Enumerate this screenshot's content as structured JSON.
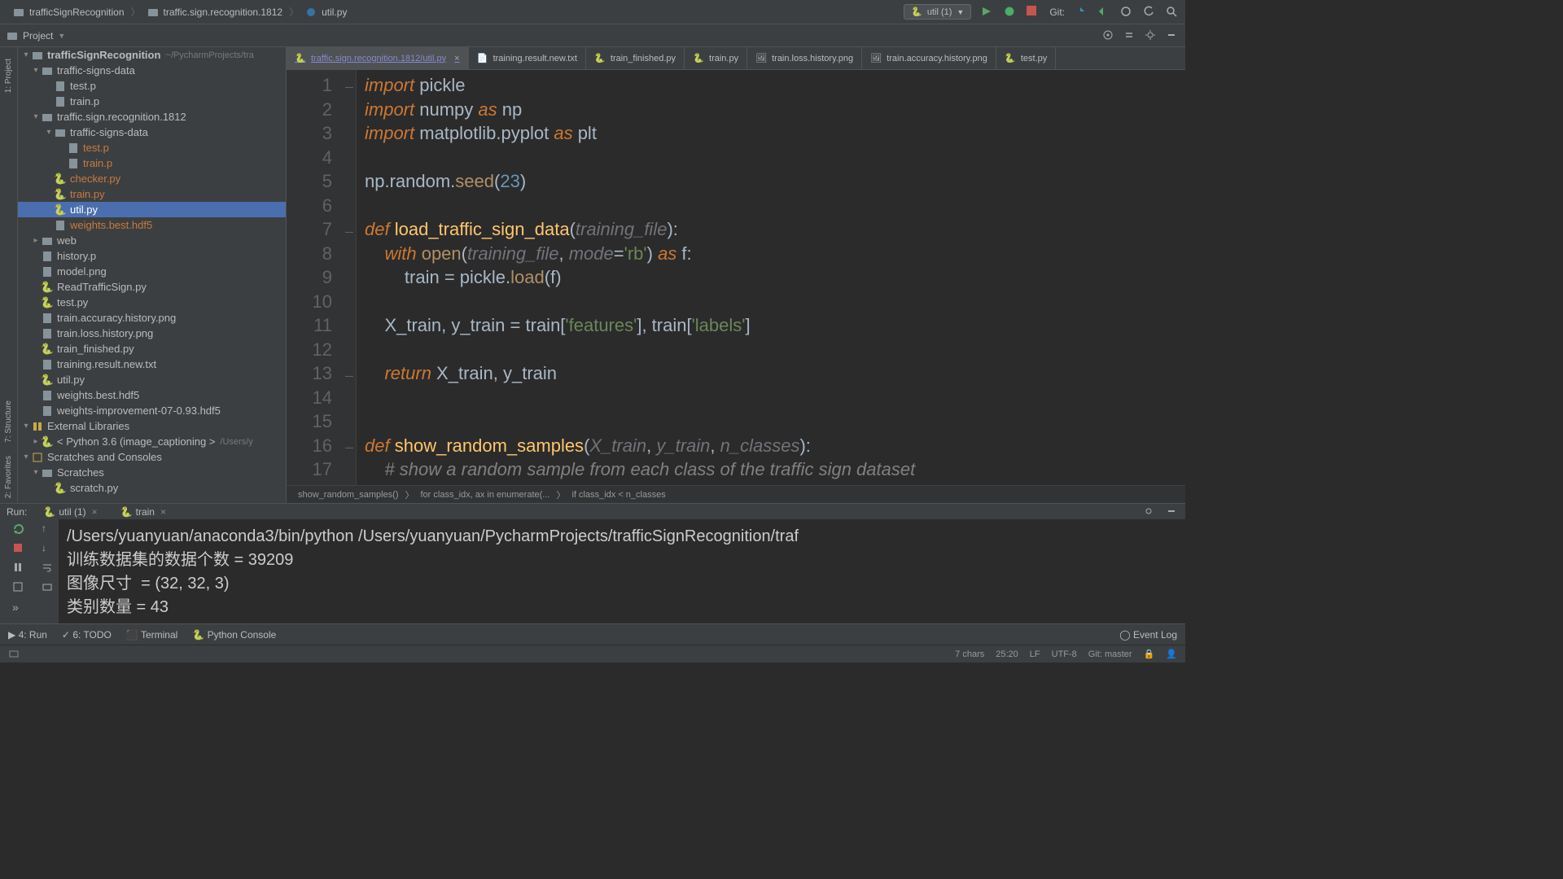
{
  "titlebar": {
    "crumbs": [
      "trafficSignRecognition",
      "traffic.sign.recognition.1812",
      "util.py"
    ]
  },
  "run_config": {
    "label": "util (1)"
  },
  "git": {
    "label": "Git:"
  },
  "project_label": "Project",
  "left_gutter": {
    "l1": "1: Project",
    "l2": "7: Structure",
    "l3": "2: Favorites"
  },
  "tree": {
    "root": "trafficSignRecognition",
    "root_path": "~/PycharmProjects/tra",
    "items": [
      {
        "depth": 1,
        "arrow": "▾",
        "icon": "folder",
        "label": "traffic-signs-data"
      },
      {
        "depth": 2,
        "arrow": "",
        "icon": "file",
        "label": "test.p"
      },
      {
        "depth": 2,
        "arrow": "",
        "icon": "file",
        "label": "train.p"
      },
      {
        "depth": 1,
        "arrow": "▾",
        "icon": "folder",
        "label": "traffic.sign.recognition.1812"
      },
      {
        "depth": 2,
        "arrow": "▾",
        "icon": "folder",
        "label": "traffic-signs-data"
      },
      {
        "depth": 3,
        "arrow": "",
        "icon": "file",
        "label": "test.p",
        "warn": true
      },
      {
        "depth": 3,
        "arrow": "",
        "icon": "file",
        "label": "train.p",
        "warn": true
      },
      {
        "depth": 2,
        "arrow": "",
        "icon": "py",
        "label": "checker.py",
        "warn": true
      },
      {
        "depth": 2,
        "arrow": "",
        "icon": "py",
        "label": "train.py",
        "warn": true
      },
      {
        "depth": 2,
        "arrow": "",
        "icon": "py",
        "label": "util.py",
        "selected": true
      },
      {
        "depth": 2,
        "arrow": "",
        "icon": "file",
        "label": "weights.best.hdf5",
        "warn": true
      },
      {
        "depth": 1,
        "arrow": "▸",
        "icon": "folder",
        "label": "web"
      },
      {
        "depth": 1,
        "arrow": "",
        "icon": "file",
        "label": "history.p"
      },
      {
        "depth": 1,
        "arrow": "",
        "icon": "file",
        "label": "model.png"
      },
      {
        "depth": 1,
        "arrow": "",
        "icon": "py",
        "label": "ReadTrafficSign.py"
      },
      {
        "depth": 1,
        "arrow": "",
        "icon": "py",
        "label": "test.py"
      },
      {
        "depth": 1,
        "arrow": "",
        "icon": "file",
        "label": "train.accuracy.history.png"
      },
      {
        "depth": 1,
        "arrow": "",
        "icon": "file",
        "label": "train.loss.history.png"
      },
      {
        "depth": 1,
        "arrow": "",
        "icon": "py",
        "label": "train_finished.py"
      },
      {
        "depth": 1,
        "arrow": "",
        "icon": "file",
        "label": "training.result.new.txt"
      },
      {
        "depth": 1,
        "arrow": "",
        "icon": "py",
        "label": "util.py"
      },
      {
        "depth": 1,
        "arrow": "",
        "icon": "file",
        "label": "weights.best.hdf5"
      },
      {
        "depth": 1,
        "arrow": "",
        "icon": "file",
        "label": "weights-improvement-07-0.93.hdf5"
      }
    ],
    "ext_lib": "External Libraries",
    "python_env": "< Python 3.6 (image_captioning >",
    "python_env_path": "/Users/y",
    "scratches": "Scratches and Consoles",
    "scratches_folder": "Scratches",
    "scratch_file": "scratch.py"
  },
  "tabs": [
    {
      "label": "traffic.sign.recognition.1812/util.py",
      "active": true,
      "warn": true,
      "icon": "py"
    },
    {
      "label": "training.result.new.txt",
      "icon": "txt"
    },
    {
      "label": "train_finished.py",
      "icon": "py"
    },
    {
      "label": "train.py",
      "icon": "py"
    },
    {
      "label": "train.loss.history.png",
      "icon": "img"
    },
    {
      "label": "train.accuracy.history.png",
      "icon": "img"
    },
    {
      "label": "test.py",
      "icon": "py"
    }
  ],
  "code": {
    "lines": 18
  },
  "crumbs": {
    "c1": "show_random_samples()",
    "c2": "for class_idx, ax in enumerate(...",
    "c3": "if class_idx < n_classes"
  },
  "run_header": {
    "label": "Run:",
    "tab1": "util (1)",
    "tab2": "train"
  },
  "console": {
    "l1": "/Users/yuanyuan/anaconda3/bin/python /Users/yuanyuan/PycharmProjects/trafficSignRecognition/traf",
    "l2": "训练数据集的数据个数 = 39209",
    "l3": "图像尺寸  = (32, 32, 3)",
    "l4": "类别数量 = 43"
  },
  "bottom": {
    "run": "4: Run",
    "todo": "6: TODO",
    "terminal": "Terminal",
    "pyconsole": "Python Console",
    "eventlog": "Event Log"
  },
  "status": {
    "chars": "7 chars",
    "pos": "25:20",
    "lf": "LF",
    "enc": "UTF-8",
    "git": "Git: master",
    "spaces": ""
  }
}
